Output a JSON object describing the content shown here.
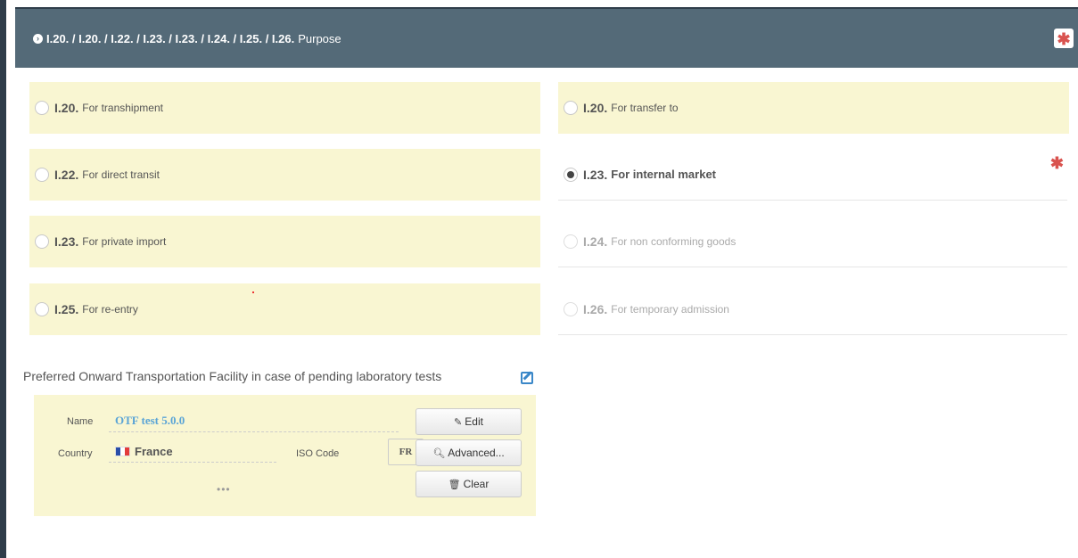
{
  "header": {
    "codes": "I.20. / I.20. / I.22. / I.23. / I.23. / I.24. / I.25. / I.26.",
    "title": "Purpose",
    "required_mark": "✱"
  },
  "options": {
    "o1": {
      "code": "I.20.",
      "label": "For transhipment"
    },
    "o2": {
      "code": "I.20.",
      "label": "For transfer to"
    },
    "o3": {
      "code": "I.22.",
      "label": "For direct transit"
    },
    "o4": {
      "code": "I.23.",
      "label": "For internal market",
      "required_mark": "✱"
    },
    "o5": {
      "code": "I.23.",
      "label": "For private import"
    },
    "o6": {
      "code": "I.24.",
      "label": "For non conforming goods"
    },
    "o7": {
      "code": "I.25.",
      "label": "For re-entry"
    },
    "o8": {
      "code": "I.26.",
      "label": "For temporary admission"
    }
  },
  "otf": {
    "title": "Preferred Onward Transportation Facility in case of pending laboratory tests",
    "name_label": "Name",
    "name_value": "OTF test 5.0.0",
    "country_label": "Country",
    "country_value": "France",
    "iso_label": "ISO Code",
    "iso_value": "FR",
    "more": "•••",
    "edit_label": "Edit",
    "advanced_label": "Advanced...",
    "clear_label": "Clear"
  },
  "colors": {
    "header_bg": "#546a78",
    "option_bg": "#f9f6d2",
    "required": "#d9534f",
    "link": "#5aa4d6"
  }
}
